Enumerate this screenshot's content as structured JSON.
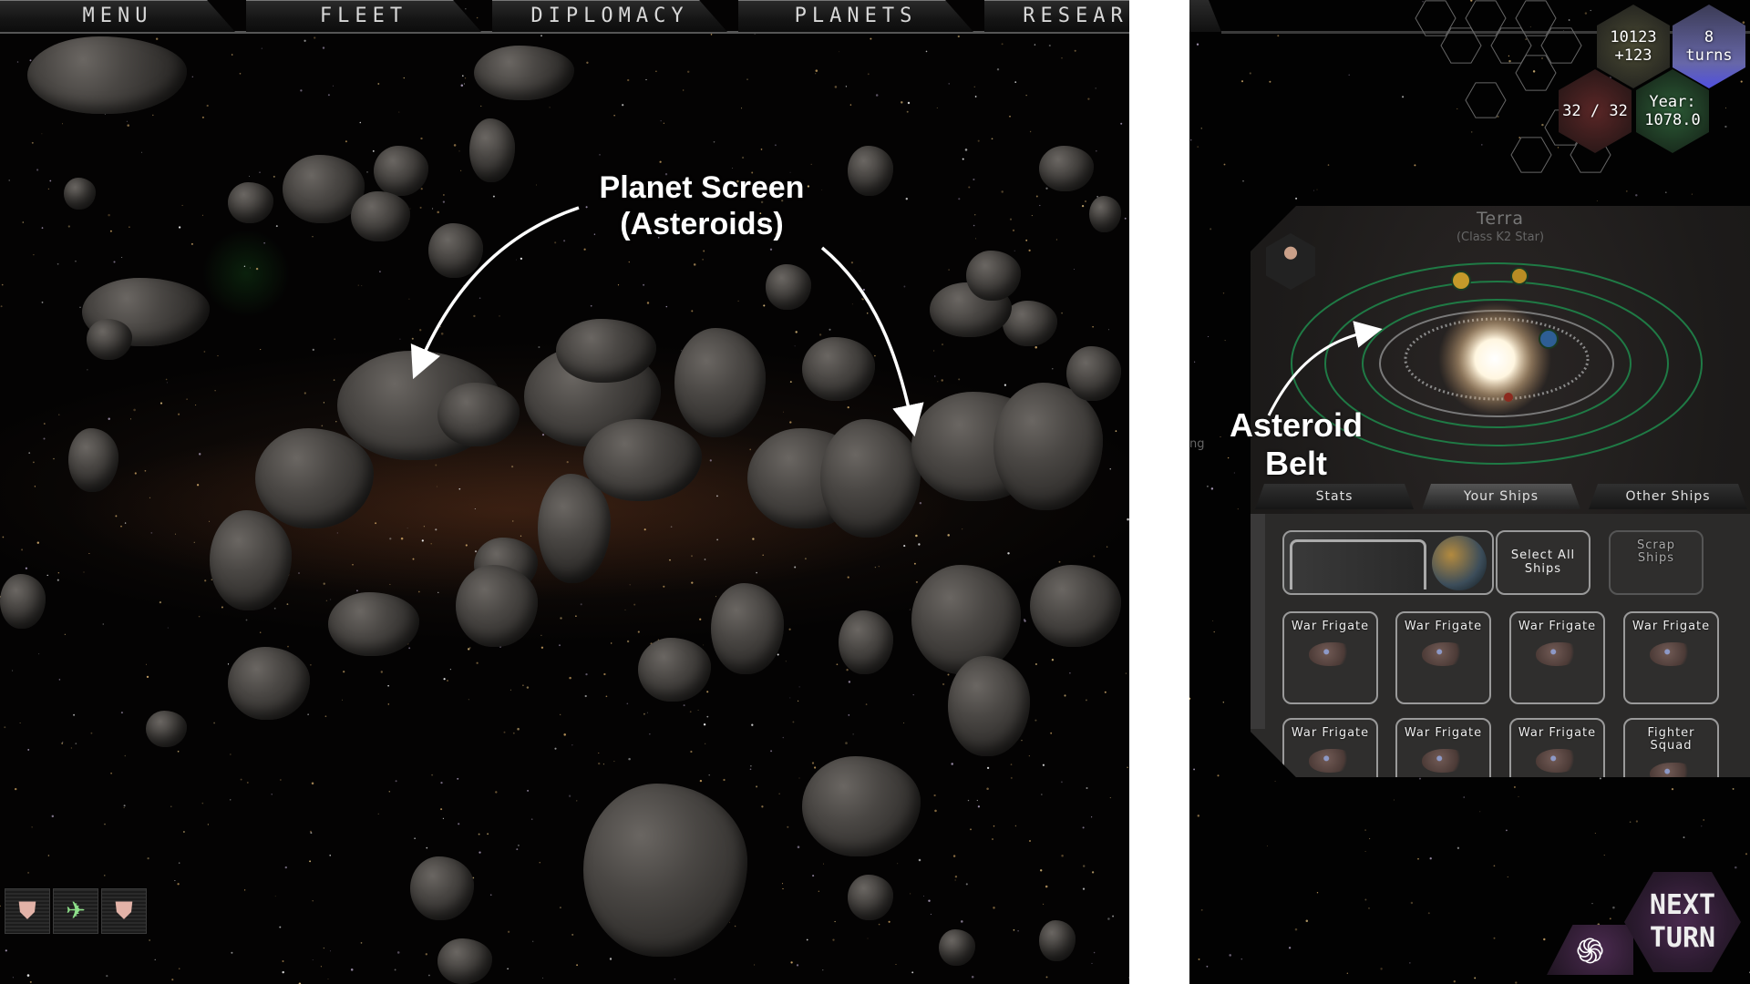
{
  "nav": {
    "tabs": [
      "MENU",
      "FLEET",
      "DIPLOMACY",
      "PLANETS",
      "RESEAR"
    ]
  },
  "annotations": {
    "planet_screen_line1": "Planet Screen",
    "planet_screen_line2": "(Asteroids)",
    "asteroid_belt_line1": "Asteroid",
    "asteroid_belt_line2": "Belt"
  },
  "fleet_icons": [
    {
      "icon": "fleet-group-icon",
      "glyph": "⛊",
      "color": "#e3b3a8"
    },
    {
      "icon": "ship-selected-icon",
      "glyph": "✈",
      "color": "#8ee08a"
    },
    {
      "icon": "fleet-group-icon",
      "glyph": "⛊",
      "color": "#e3b3a8"
    }
  ],
  "hud": {
    "credits": "10123",
    "credits_delta": "+123",
    "research_turns_value": "8",
    "research_turns_label": "turns",
    "fleet_capacity": "32 / 32",
    "year_label": "Year:",
    "year_value": "1078.0"
  },
  "system": {
    "name": "Terra",
    "star_class": "(Class K2 Star)",
    "tabs": [
      {
        "label": "Stats",
        "active": false
      },
      {
        "label": "Your Ships",
        "active": true
      },
      {
        "label": "Other Ships",
        "active": false
      }
    ],
    "actions": {
      "select_all": "Select All Ships",
      "scrap": "Scrap Ships"
    },
    "ships": [
      "War Frigate",
      "War Frigate",
      "War Frigate",
      "War Frigate",
      "War Frigate",
      "War Frigate",
      "War Frigate",
      "Fighter Squad"
    ],
    "orbit_color": "#1f7a45",
    "belt_orbit_color": "#7a7a7a"
  },
  "partial_text": "ng",
  "next_turn": {
    "line1": "NEXT",
    "line2": "TURN"
  },
  "colors": {
    "accent_purple": "#4a2a4f",
    "text_light": "#e0e0e0"
  }
}
